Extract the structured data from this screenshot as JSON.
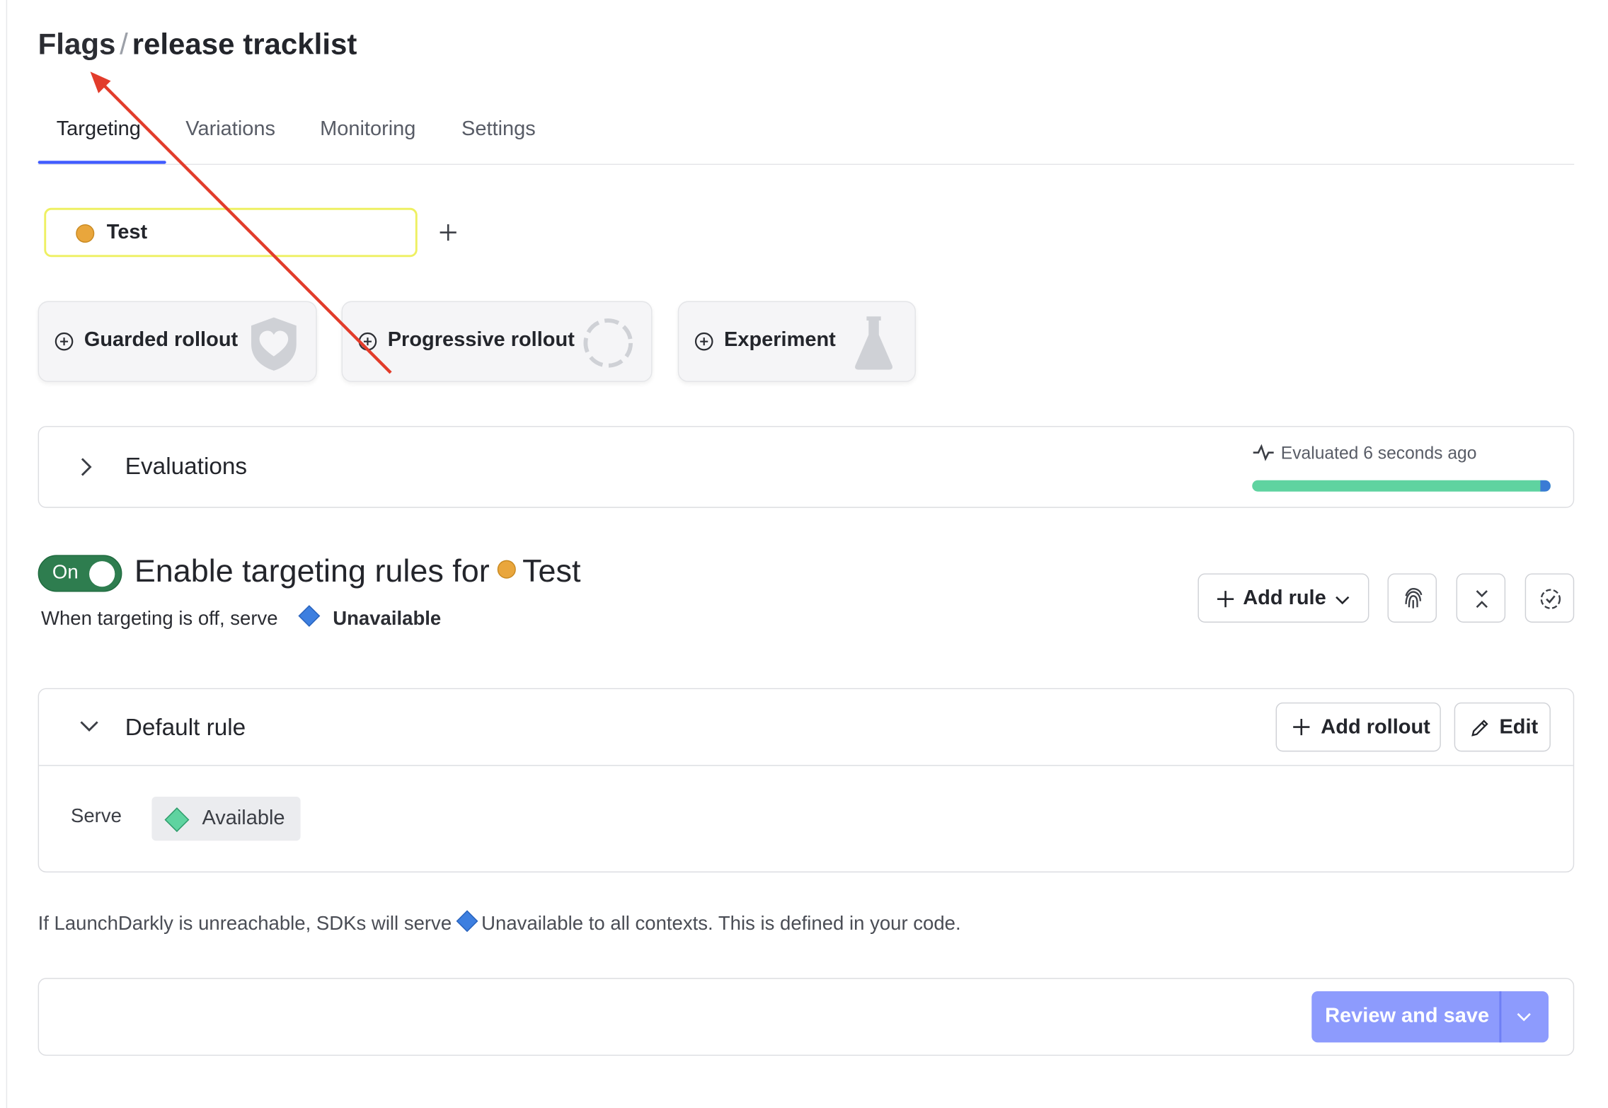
{
  "breadcrumb": {
    "parent": "Flags",
    "separator": "/",
    "current": "release tracklist"
  },
  "tabs": [
    {
      "label": "Targeting",
      "active": true
    },
    {
      "label": "Variations",
      "active": false
    },
    {
      "label": "Monitoring",
      "active": false
    },
    {
      "label": "Settings",
      "active": false
    }
  ],
  "environment": {
    "name": "Test",
    "color": "#e9a63c",
    "add_icon": "plus-icon"
  },
  "rollout_options": [
    {
      "label": "Guarded rollout",
      "icon": "shield-heart-icon"
    },
    {
      "label": "Progressive rollout",
      "icon": "dashed-circle-icon"
    },
    {
      "label": "Experiment",
      "icon": "flask-icon"
    }
  ],
  "evaluations": {
    "label": "Evaluations",
    "status": "Evaluated 6 seconds ago",
    "bar_colors": {
      "primary": "#5fd3a0",
      "secondary": "#3a7bd5"
    }
  },
  "targeting": {
    "toggle_label": "On",
    "heading_prefix": "Enable targeting rules for",
    "environment": "Test",
    "off_serve_prefix": "When targeting is off, serve",
    "off_variation": "Unavailable",
    "add_rule": "Add rule"
  },
  "default_rule": {
    "title": "Default rule",
    "add_rollout": "Add rollout",
    "edit": "Edit",
    "serve_label": "Serve",
    "variation": "Available"
  },
  "footnote": {
    "prefix": "If LaunchDarkly is unreachable, SDKs will serve",
    "variation": "Unavailable",
    "suffix": "to all contexts. This is defined in your code."
  },
  "save": {
    "label": "Review and save",
    "color": "#8d9bfd"
  },
  "annotation": {
    "color": "#e23c2b",
    "icon": "red-arrow-annotation"
  }
}
